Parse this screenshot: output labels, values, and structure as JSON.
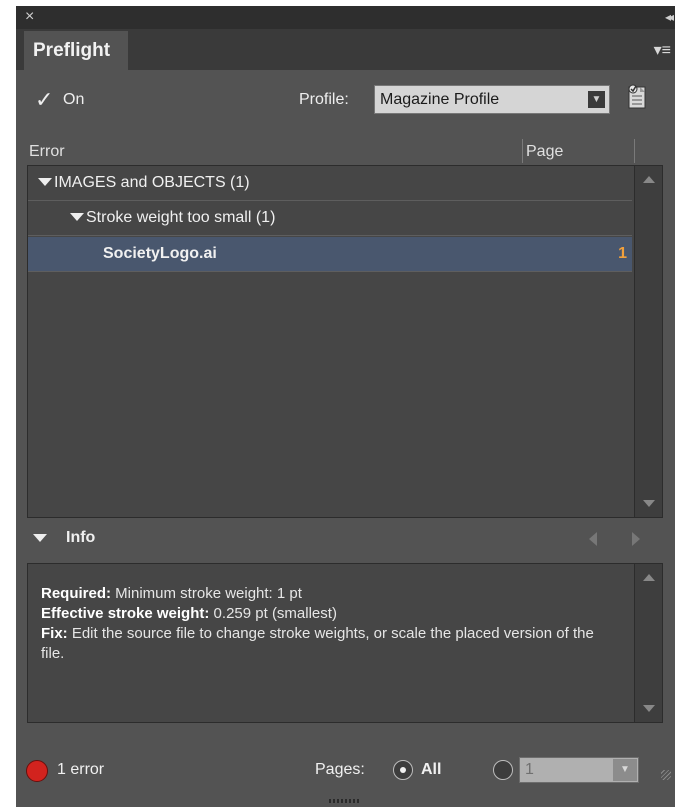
{
  "window": {
    "close_icon": "×",
    "collapse_icon": "◂◂"
  },
  "tab": {
    "label": "Preflight",
    "menu_icon": "▾≡"
  },
  "top": {
    "on_label": "On",
    "on_checked": true,
    "profile_label": "Profile:",
    "profile_value": "Magazine Profile",
    "dropdown_icon": "▼"
  },
  "columns": {
    "error": "Error",
    "page": "Page"
  },
  "errors": {
    "group": "IMAGES and OBJECTS (1)",
    "subgroup": "Stroke weight too small (1)",
    "item": "SocietyLogo.ai",
    "item_page": "1"
  },
  "info": {
    "label": "Info",
    "required_label": "Required:",
    "required_value": " Minimum stroke weight: 1 pt",
    "effective_label": "Effective stroke weight:",
    "effective_value": " 0.259 pt (smallest)",
    "fix_label": "Fix:",
    "fix_value": " Edit the source file to change stroke weights, or scale the placed version of the file."
  },
  "status": {
    "error_text": "1 error",
    "error_color": "#d2231e",
    "pages_label": "Pages:",
    "all_label": "All",
    "range_value": "1",
    "range_arrow": "▼"
  },
  "colors": {
    "panel_bg": "#535353",
    "selected_row": "#49576e",
    "page_number": "#f1a03c"
  }
}
